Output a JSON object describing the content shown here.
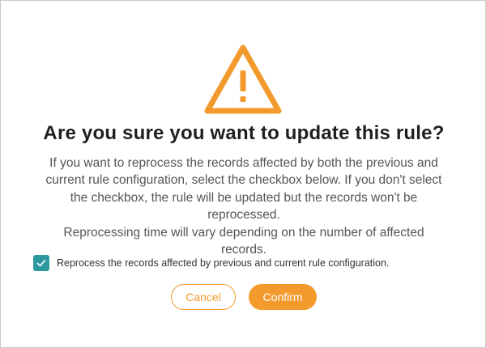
{
  "dialog": {
    "icon": "warning-triangle-icon",
    "title": "Are you sure you want to update this rule?",
    "body": {
      "lines": [
        "If you want to reprocess the records affected by both the previous and",
        "current rule configuration, select the checkbox below. If you don't select",
        "the checkbox, the rule will be updated but the records won't be",
        "reprocessed.",
        "Reprocessing time will vary depending on the number of affected",
        "records."
      ]
    },
    "checkbox": {
      "checked": true,
      "label": "Reprocess the records affected by previous and current rule configuration."
    },
    "buttons": {
      "cancel": "Cancel",
      "confirm": "Confirm"
    }
  },
  "colors": {
    "accent": "#f39a2c",
    "checkbox": "#2e9aa0",
    "title": "#1f1f1f",
    "body_text": "#555555",
    "border": "#c9c9c9"
  }
}
